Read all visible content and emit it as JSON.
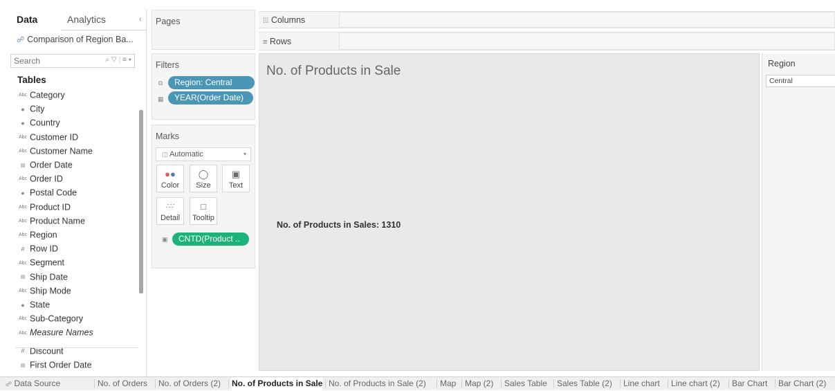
{
  "left_pane": {
    "tabs": {
      "data": "Data",
      "analytics": "Analytics"
    },
    "data_source": "Comparison of Region Ba...",
    "search_placeholder": "Search",
    "tables_heading": "Tables",
    "fields": [
      {
        "type": "Abc",
        "name": "Category"
      },
      {
        "type": "geo",
        "name": "City"
      },
      {
        "type": "geo",
        "name": "Country"
      },
      {
        "type": "Abc",
        "name": "Customer ID"
      },
      {
        "type": "Abc",
        "name": "Customer Name"
      },
      {
        "type": "date",
        "name": "Order Date"
      },
      {
        "type": "Abc",
        "name": "Order ID"
      },
      {
        "type": "geo",
        "name": "Postal Code"
      },
      {
        "type": "Abc",
        "name": "Product ID"
      },
      {
        "type": "Abc",
        "name": "Product Name"
      },
      {
        "type": "Abc",
        "name": "Region"
      },
      {
        "type": "#",
        "name": "Row ID"
      },
      {
        "type": "Abc",
        "name": "Segment"
      },
      {
        "type": "date",
        "name": "Ship Date"
      },
      {
        "type": "Abc",
        "name": "Ship Mode"
      },
      {
        "type": "geo",
        "name": "State"
      },
      {
        "type": "Abc",
        "name": "Sub-Category"
      },
      {
        "type": "Abc",
        "name": "Measure Names",
        "italic": true
      },
      {
        "type": "#",
        "name": "Discount"
      },
      {
        "type": "date",
        "name": "First Order Date"
      }
    ]
  },
  "shelves": {
    "pages": "Pages",
    "filters": {
      "title": "Filters",
      "pills": [
        "Region: Central",
        "YEAR(Order Date)"
      ]
    },
    "marks": {
      "title": "Marks",
      "type_select": "Automatic",
      "buttons": {
        "color": "Color",
        "size": "Size",
        "text": "Text",
        "detail": "Detail",
        "tooltip": "Tooltip"
      },
      "pill": "CNTD(Product .."
    },
    "columns": "Columns",
    "rows": "Rows"
  },
  "view": {
    "title": "No. of Products in Sale",
    "text": "No. of Products in Sales: 1310"
  },
  "region_filter": {
    "title": "Region",
    "selected": "Central"
  },
  "sheet_tabs": {
    "data_source": "Data Source",
    "sheets": [
      "No. of Orders",
      "No. of Orders (2)",
      "No. of Products in Sale",
      "No. of Products in Sale (2)",
      "Map",
      "Map (2)",
      "Sales Table",
      "Sales Table (2)",
      "Line chart",
      "Line chart (2)",
      "Bar Chart",
      "Bar Chart (2)"
    ],
    "active": "No. of Products in Sale"
  },
  "colors": {
    "filter_pill": "#4a96b6",
    "measure_pill": "#1db27a",
    "view_bg": "#e9e9e9"
  }
}
